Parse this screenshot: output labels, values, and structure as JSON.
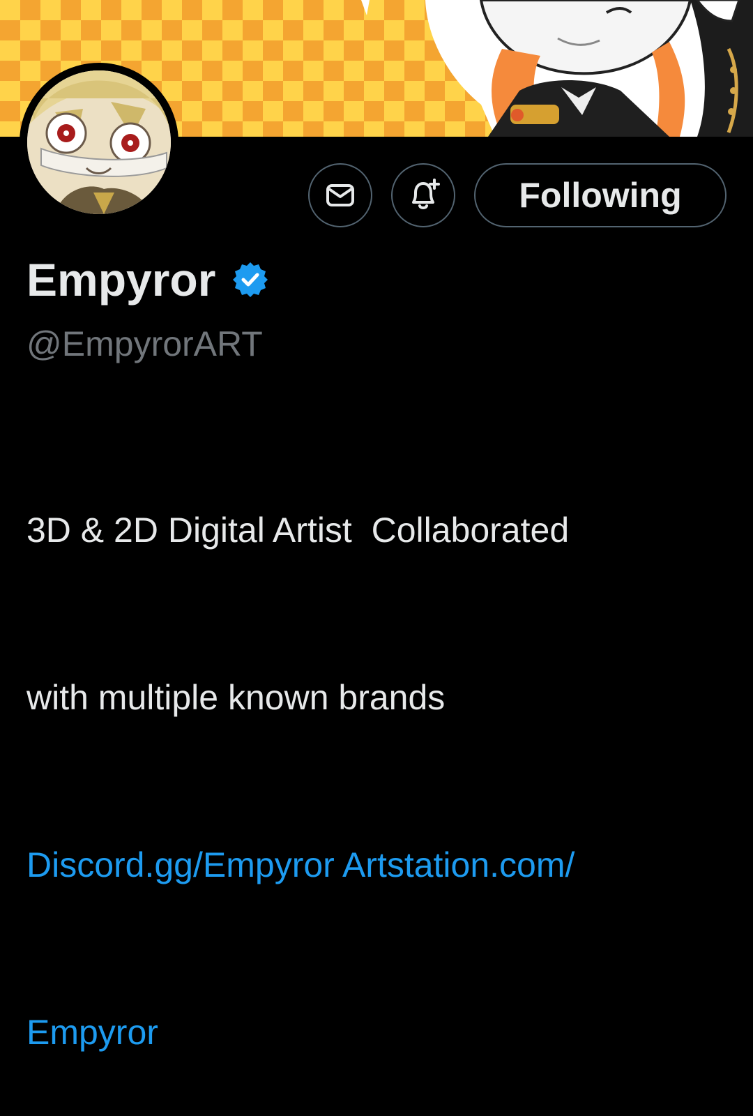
{
  "profile": {
    "display_name": "Empyror",
    "handle": "@EmpyrorART",
    "verified": true,
    "bio_line_1": "3D & 2D Digital Artist  Collaborated",
    "bio_line_2": "with multiple known brands",
    "link_1": "Discord.gg/Empyror",
    "link_2": "Artstation.com/",
    "link_2_cont": "Empyror"
  },
  "actions": {
    "message_icon": "envelope-icon",
    "notify_icon": "bell-plus-icon",
    "following_label": "Following"
  },
  "colors": {
    "background": "#000000",
    "text_primary": "#e7e9ea",
    "text_secondary": "#71767b",
    "link": "#1d9bf0",
    "verified_badge": "#1d9bf0",
    "button_border": "#536471",
    "banner_primary": "#ffd34a",
    "banner_secondary": "#f4a531"
  }
}
